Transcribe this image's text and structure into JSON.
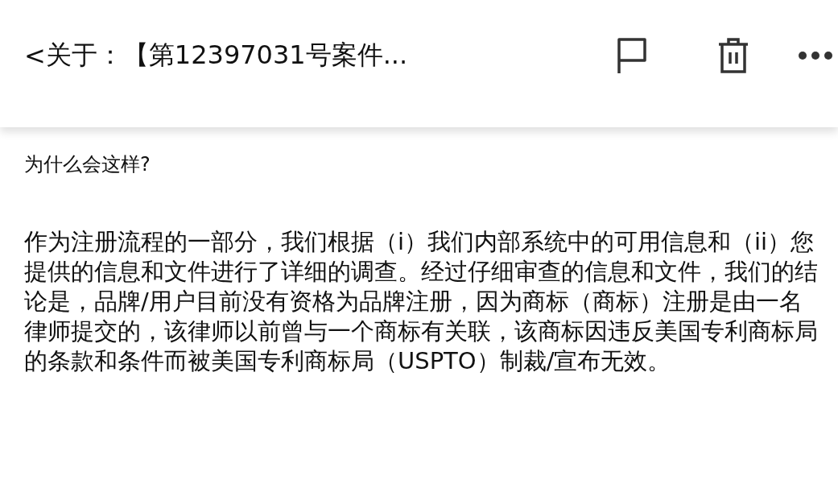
{
  "header": {
    "back": "<",
    "title": "关于：【第12397031号案件..."
  },
  "body": {
    "question": "为什么会这样?",
    "paragraph": "作为注册流程的一部分，我们根据（i）我们内部系统中的可用信息和（ii）您提供的信息和文件进行了详细的调查。经过仔细审查的信息和文件，我们的结论是，品牌/用户目前没有资格为品牌注册，因为商标（商标）注册是由一名律师提交的，该律师以前曾与一个商标有关联，该商标因违反美国专利商标局的条款和条件而被美国专利商标局（USPTO）制裁/宣布无效。"
  }
}
